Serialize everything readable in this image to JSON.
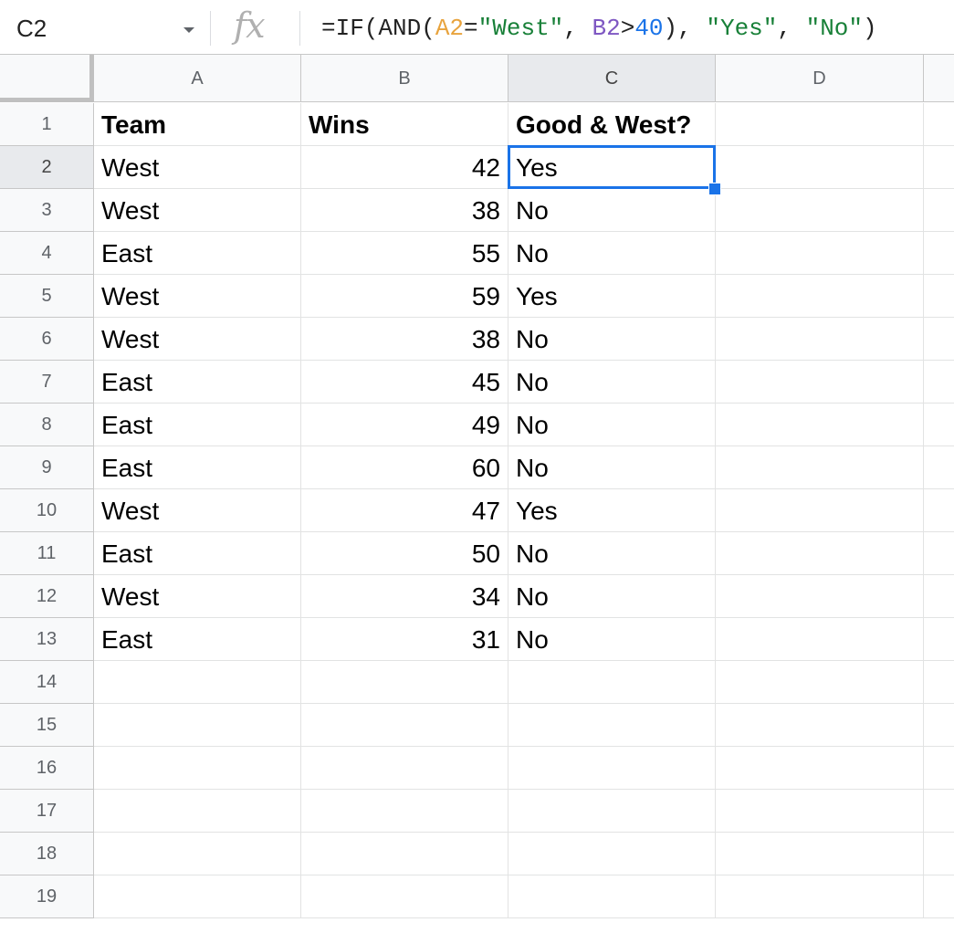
{
  "name_box": "C2",
  "fx_label": "fx",
  "formula": {
    "p1": "=IF(AND(",
    "ref1": "A2",
    "p2": "=",
    "str1": "\"West\"",
    "p3": ", ",
    "ref2": "B2",
    "p4": ">",
    "num": "40",
    "p5": "), ",
    "str2": "\"Yes\"",
    "p6": ", ",
    "str3": "\"No\"",
    "p7": ")"
  },
  "columns": [
    "A",
    "B",
    "C",
    "D"
  ],
  "selected_column": "C",
  "selected_row": 2,
  "row_numbers": [
    "1",
    "2",
    "3",
    "4",
    "5",
    "6",
    "7",
    "8",
    "9",
    "10",
    "11",
    "12",
    "13",
    "14",
    "15",
    "16",
    "17",
    "18",
    "19"
  ],
  "header_row": [
    "Team",
    "Wins",
    "Good & West?"
  ],
  "data_rows": [
    [
      "West",
      "42",
      "Yes"
    ],
    [
      "West",
      "38",
      "No"
    ],
    [
      "East",
      "55",
      "No"
    ],
    [
      "West",
      "59",
      "Yes"
    ],
    [
      "West",
      "38",
      "No"
    ],
    [
      "East",
      "45",
      "No"
    ],
    [
      "East",
      "49",
      "No"
    ],
    [
      "East",
      "60",
      "No"
    ],
    [
      "West",
      "47",
      "Yes"
    ],
    [
      "East",
      "50",
      "No"
    ],
    [
      "West",
      "34",
      "No"
    ],
    [
      "East",
      "31",
      "No"
    ]
  ],
  "colors": {
    "selection": "#1a73e8",
    "ref_a2": "#e8a33d",
    "ref_b2": "#7e57c2",
    "string": "#188038",
    "number": "#1a73e8"
  }
}
